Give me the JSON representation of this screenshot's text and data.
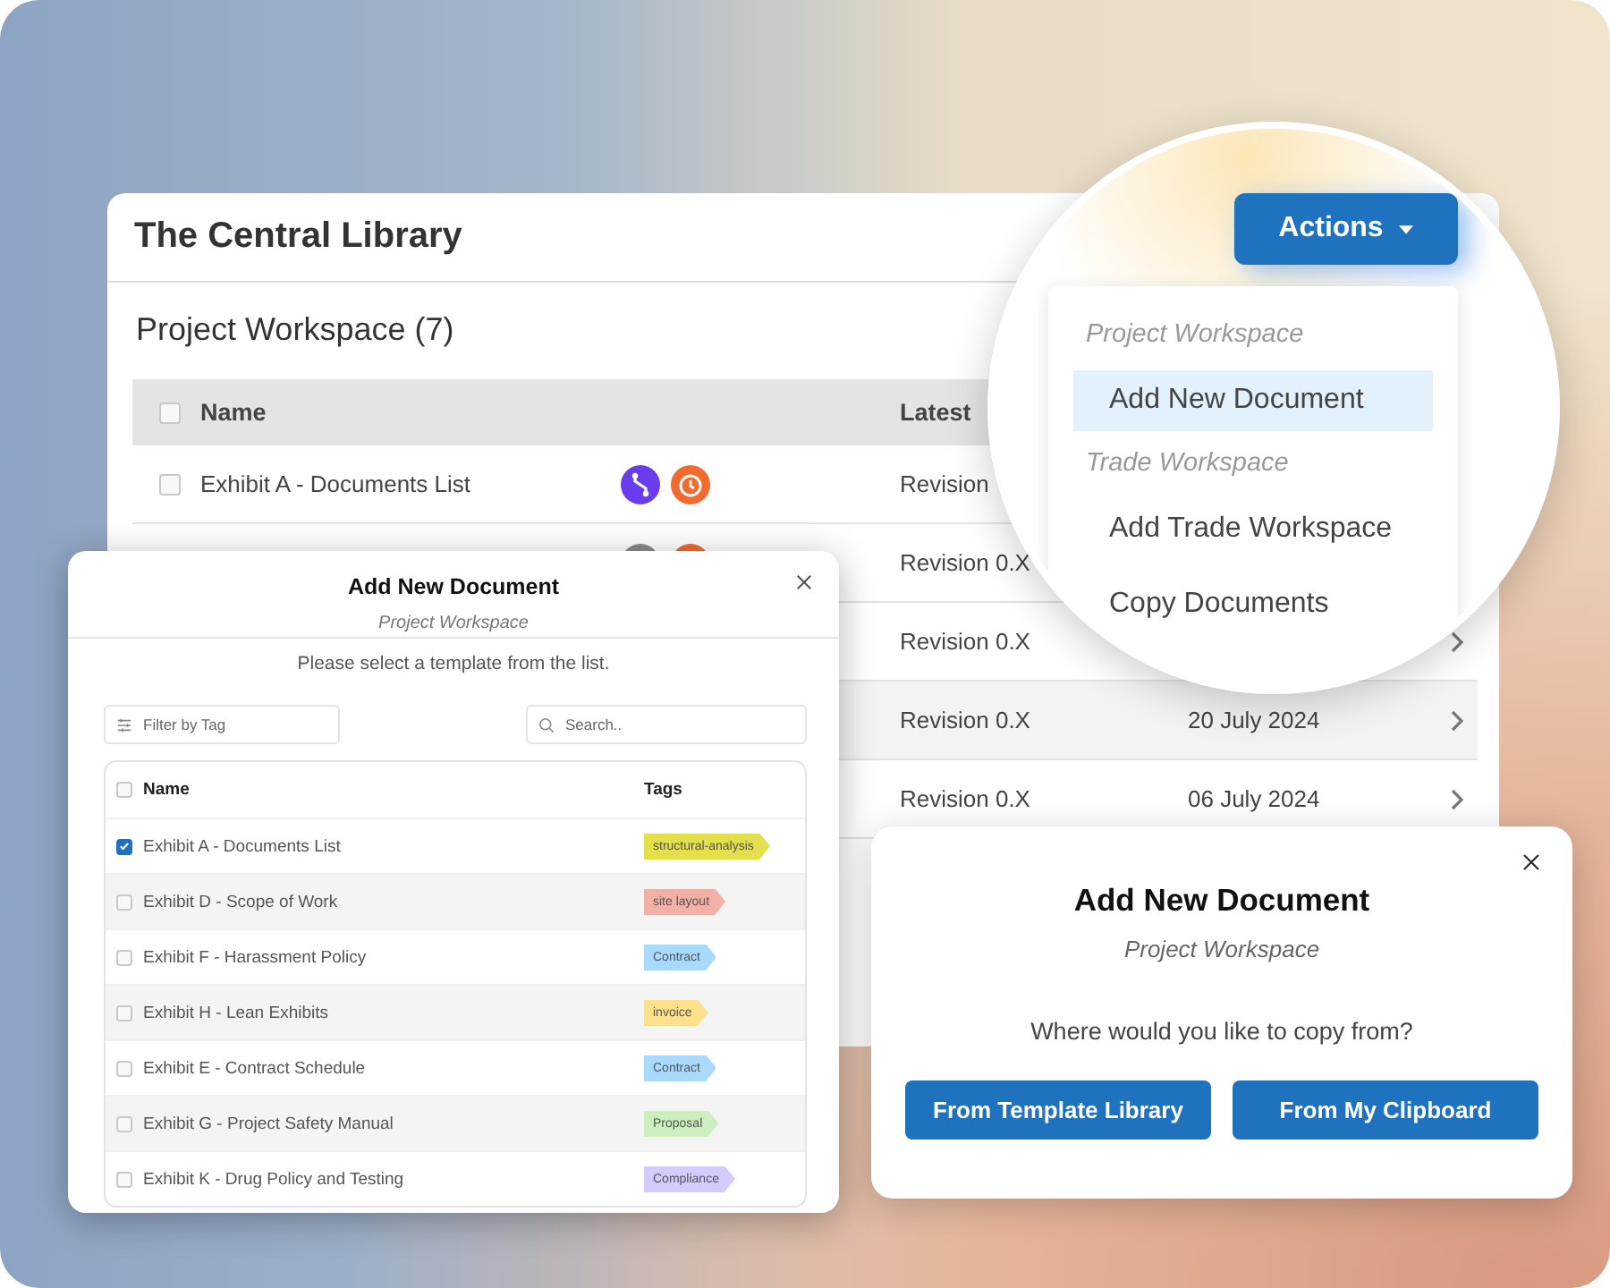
{
  "library": {
    "title": "The Central Library",
    "section": "Project Workspace (7)",
    "columns": [
      "Name",
      "Latest"
    ],
    "all_checked": false,
    "rows": [
      {
        "checked": false,
        "name": "Exhibit A - Documents List",
        "icons": true,
        "revision": "Revision",
        "hovered": false
      },
      {
        "icons": true,
        "revision": "Revision 0.X",
        "hovered": false
      },
      {
        "revision": "Revision 0.X",
        "chevron": true,
        "hovered": false
      },
      {
        "revision": "Revision 0.X",
        "date": "20 July 2024",
        "chevron": true,
        "hovered": true
      },
      {
        "revision": "Revision 0.X",
        "date": "06 July 2024",
        "chevron": true,
        "hovered": false
      }
    ]
  },
  "actions": {
    "button": "Actions",
    "menu": [
      {
        "kind": "header",
        "label": "Project Workspace"
      },
      {
        "kind": "item",
        "label": "Add New Document",
        "selected": true
      },
      {
        "kind": "header",
        "label": "Trade Workspace"
      },
      {
        "kind": "item",
        "label": "Add Trade Workspace",
        "selected": false
      },
      {
        "kind": "item",
        "label": "Copy Documents",
        "selected": false
      }
    ]
  },
  "template_dialog": {
    "title": "Add New Document",
    "subtitle": "Project Workspace",
    "instruction": "Please select a template from the list.",
    "filter": {
      "placeholder": "Filter by Tag"
    },
    "search": {
      "placeholder": "Search.."
    },
    "columns": [
      "Name",
      "Tags"
    ],
    "all_checked": false,
    "rows": [
      {
        "name": "Exhibit A - Documents List",
        "checked": true,
        "tag": "structural-analysis",
        "color": "#e3e04c"
      },
      {
        "name": "Exhibit D - Scope of Work",
        "checked": false,
        "tag": "site layout",
        "color": "#f2b1a6"
      },
      {
        "name": "Exhibit F - Harassment Policy",
        "checked": false,
        "tag": "Contract",
        "color": "#a9d9fd"
      },
      {
        "name": "Exhibit H - Lean Exhibits",
        "checked": false,
        "tag": "invoice",
        "color": "#fde08c"
      },
      {
        "name": "Exhibit E - Contract Schedule",
        "checked": false,
        "tag": "Contract",
        "color": "#a9d9fd"
      },
      {
        "name": "Exhibit G - Project Safety Manual",
        "checked": false,
        "tag": "Proposal",
        "color": "#cdefbf"
      },
      {
        "name": "Exhibit K - Drug Policy and Testing",
        "checked": false,
        "tag": "Compliance",
        "color": "#d6cbfd"
      }
    ]
  },
  "copy_dialog": {
    "title": "Add New Document",
    "subtitle": "Project Workspace",
    "question": "Where would you like to copy from?",
    "buttons": [
      "From Template Library",
      "From My Clipboard"
    ]
  }
}
